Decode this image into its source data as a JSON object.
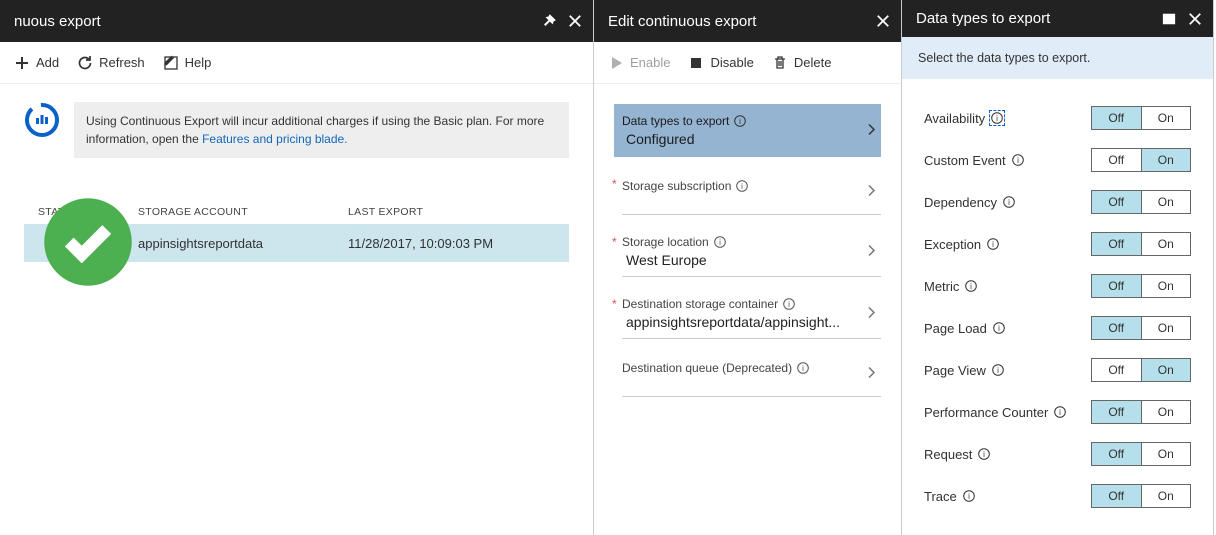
{
  "blades": {
    "left": {
      "title": "nuous export",
      "toolbar": {
        "add": "Add",
        "refresh": "Refresh",
        "help": "Help"
      },
      "info": {
        "text": "Using Continuous Export will incur additional charges if using the Basic plan. For more information, open the",
        "link": "Features and pricing blade."
      },
      "table": {
        "headers": {
          "status": "STATUS",
          "storage_account": "STORAGE ACCOUNT",
          "last_export": "LAST EXPORT"
        },
        "row": {
          "storage_account": "appinsightsreportdata",
          "last_export": "11/28/2017, 10:09:03 PM"
        }
      }
    },
    "middle": {
      "title": "Edit continuous export",
      "toolbar": {
        "enable": "Enable",
        "disable": "Disable",
        "delete": "Delete"
      },
      "rows": {
        "data_types": {
          "label": "Data types to export",
          "value": "Configured"
        },
        "subscription": {
          "label": "Storage subscription"
        },
        "location": {
          "label": "Storage location",
          "value": "West Europe"
        },
        "container": {
          "label": "Destination storage container",
          "value": "appinsightsreportdata/appinsight..."
        },
        "queue": {
          "label": "Destination queue (Deprecated)"
        }
      }
    },
    "right": {
      "title": "Data types to export",
      "banner": "Select the data types to export.",
      "off": "Off",
      "on": "On",
      "items": [
        {
          "label": "Availability",
          "value": "Off",
          "focused": true
        },
        {
          "label": "Custom Event",
          "value": "On"
        },
        {
          "label": "Dependency",
          "value": "Off"
        },
        {
          "label": "Exception",
          "value": "Off"
        },
        {
          "label": "Metric",
          "value": "Off"
        },
        {
          "label": "Page Load",
          "value": "Off"
        },
        {
          "label": "Page View",
          "value": "On"
        },
        {
          "label": "Performance Counter",
          "value": "Off"
        },
        {
          "label": "Request",
          "value": "Off"
        },
        {
          "label": "Trace",
          "value": "Off"
        }
      ]
    }
  }
}
